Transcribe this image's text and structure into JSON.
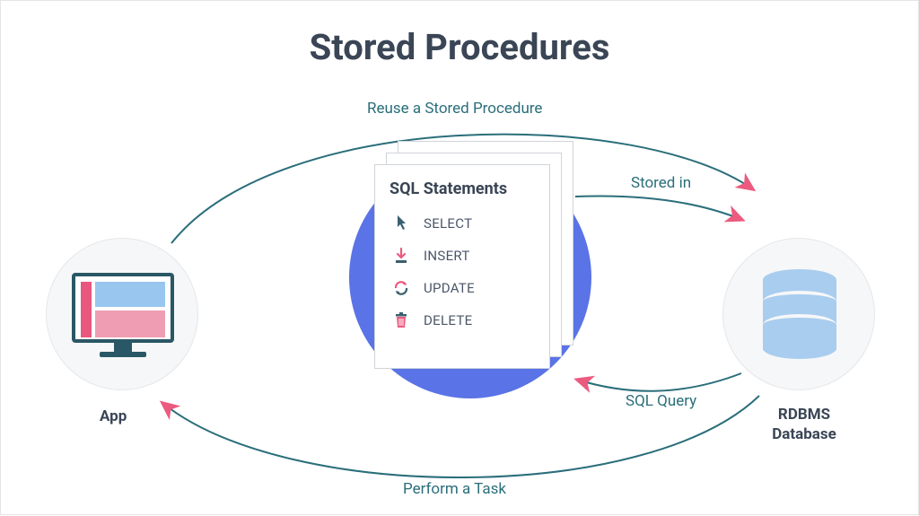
{
  "title": "Stored Procedures",
  "labels": {
    "reuse": "Reuse a Stored Procedure",
    "stored_in": "Stored in",
    "sql_query": "SQL Query",
    "perform": "Perform a Task"
  },
  "card": {
    "title": "SQL Statements",
    "statements": [
      {
        "icon": "pointer-icon",
        "label": "SELECT"
      },
      {
        "icon": "download-icon",
        "label": "INSERT"
      },
      {
        "icon": "refresh-icon",
        "label": "UPDATE"
      },
      {
        "icon": "trash-icon",
        "label": "DELETE"
      }
    ]
  },
  "nodes": {
    "app": "App",
    "db_line1": "RDBMS",
    "db_line2": "Database"
  },
  "colors": {
    "teal": "#2a6e7a",
    "pink": "#ec5a7f",
    "blue": "#5a73e6",
    "lightblue": "#a8cdef",
    "heading": "#3a4555"
  }
}
